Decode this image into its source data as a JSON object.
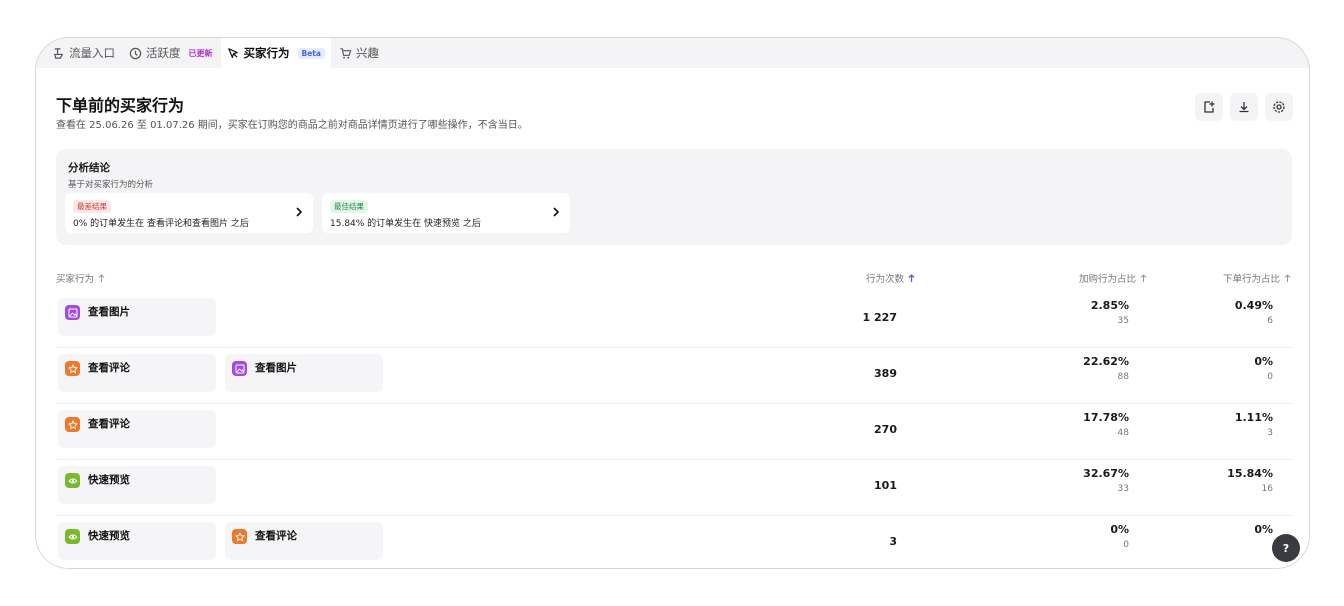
{
  "tabs": [
    {
      "label": "流量入口",
      "icon": "funnel-icon",
      "badge": ""
    },
    {
      "label": "活跃度",
      "icon": "clock-icon",
      "badge": "已更新"
    },
    {
      "label": "买家行为",
      "icon": "cursor-icon",
      "badge": "Beta"
    },
    {
      "label": "兴趣",
      "icon": "cart-icon",
      "badge": ""
    }
  ],
  "header": {
    "title": "下单前的买家行为",
    "subtitle": "查看在 25.06.26 至 01.07.26 期间，买家在订购您的商品之前对商品详情页进行了哪些操作，不含当日。"
  },
  "toolbar": {
    "icons": [
      "export-icon",
      "download-icon",
      "settings-icon"
    ]
  },
  "analysis": {
    "title": "分析结论",
    "subtitle": "基于对买家行为的分析",
    "findings": [
      {
        "tag": "最差结果",
        "text": "0% 的订单发生在 查看评论和查看图片 之后"
      },
      {
        "tag": "最佳结果",
        "text": "15.84% 的订单发生在 快速预览 之后"
      }
    ]
  },
  "table": {
    "columns": [
      "买家行为",
      "行为次数",
      "加购行为占比",
      "下单行为占比"
    ],
    "rows": [
      {
        "actions": [
          {
            "label": "查看图片",
            "icon": "image-icon"
          }
        ],
        "count": "1 227",
        "cart_pct": "2.85%",
        "cart_n": "35",
        "order_pct": "0.49%",
        "order_n": "6"
      },
      {
        "actions": [
          {
            "label": "查看评论",
            "icon": "star-icon"
          },
          {
            "label": "查看图片",
            "icon": "image-icon"
          }
        ],
        "count": "389",
        "cart_pct": "22.62%",
        "cart_n": "88",
        "order_pct": "0%",
        "order_n": "0"
      },
      {
        "actions": [
          {
            "label": "查看评论",
            "icon": "star-icon"
          }
        ],
        "count": "270",
        "cart_pct": "17.78%",
        "cart_n": "48",
        "order_pct": "1.11%",
        "order_n": "3"
      },
      {
        "actions": [
          {
            "label": "快速预览",
            "icon": "eye-icon"
          }
        ],
        "count": "101",
        "cart_pct": "32.67%",
        "cart_n": "33",
        "order_pct": "15.84%",
        "order_n": "16"
      },
      {
        "actions": [
          {
            "label": "快速预览",
            "icon": "eye-icon"
          },
          {
            "label": "查看评论",
            "icon": "star-icon"
          }
        ],
        "count": "3",
        "cart_pct": "0%",
        "cart_n": "0",
        "order_pct": "0%",
        "order_n": ""
      }
    ]
  },
  "help": {
    "label": "?"
  }
}
